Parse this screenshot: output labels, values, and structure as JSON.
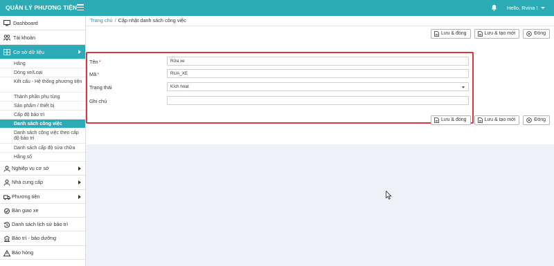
{
  "app": {
    "title": "QUẢN LÝ PHƯƠNG TIỆN"
  },
  "header": {
    "user_greeting": "Hello, Rvina !"
  },
  "sidebar": {
    "items": [
      {
        "label": "Dashboard",
        "icon": "monitor-icon"
      },
      {
        "label": "Tài khoản",
        "icon": "users-icon"
      },
      {
        "label": "Cơ sở dữ liệu",
        "icon": "database-icon",
        "active": true
      },
      {
        "label": "Nghiệp vụ cơ sở",
        "icon": "user-icon"
      },
      {
        "label": "Nhà cung cấp",
        "icon": "user-icon"
      },
      {
        "label": "Phương tiện",
        "icon": "truck-icon"
      },
      {
        "label": "Bàn giao xe",
        "icon": "handover-icon"
      },
      {
        "label": "Danh sách lịch sử bảo trì",
        "icon": "history-icon"
      },
      {
        "label": "Bảo trì - bảo dưỡng",
        "icon": "building-icon"
      },
      {
        "label": "Báo hỏng",
        "icon": "alert-icon"
      }
    ],
    "subitems": [
      "Hãng",
      "Dòng xe/Loại",
      "Kết cấu - Hệ thống phương tiện",
      "Thành phần phụ tùng",
      "Sản phẩm / thiết bị",
      "Cấp độ bảo trì",
      "Danh sách công việc",
      "Danh sách công việc theo cấp độ bảo trì",
      "Danh sách cấp độ sửa chữa",
      "Hằng số"
    ]
  },
  "breadcrumb": {
    "home": "Trang chủ",
    "separator": "/",
    "current": "Cập nhật danh sách công việc"
  },
  "toolbar": {
    "save_close": "Lưu & đóng",
    "save_new": "Lưu & tạo mới",
    "close": "Đóng"
  },
  "form": {
    "name_label": "Tên",
    "name_value": "Rửa xe",
    "code_label": "Mã",
    "code_value": "RUA_XE",
    "status_label": "Trạng thái",
    "status_value": "Kích hoạt",
    "note_label": "Ghi chú",
    "note_value": "",
    "required_mark": "*"
  },
  "colors": {
    "accent": "#2cabb6",
    "highlight_border": "#e0343a",
    "link": "#2a8fd4"
  }
}
